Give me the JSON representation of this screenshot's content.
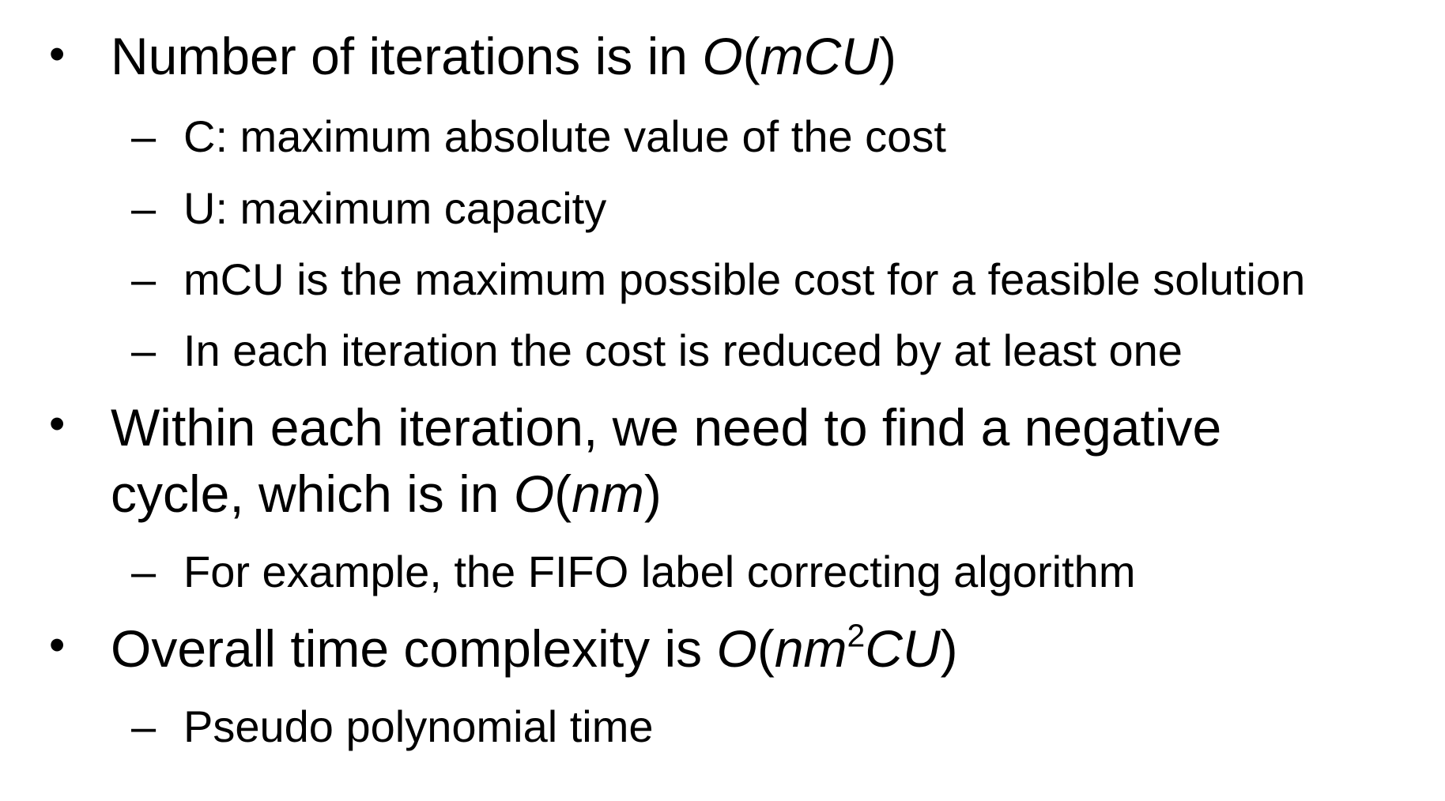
{
  "slide": {
    "bullet_symbol": "•",
    "dash_symbol": "–",
    "items": [
      {
        "text_before": "Number of iterations is in ",
        "math_big": "O",
        "open_paren": "(",
        "math_args": "mCU",
        "close_paren": ")",
        "subitems": [
          "C: maximum absolute value of the cost",
          "U: maximum capacity",
          "mCU is the maximum possible cost for a feasible solution",
          "In each iteration the cost is reduced by at least one"
        ]
      },
      {
        "line1": "Within each iteration, we need to find a negative",
        "line2_before": "cycle, which is in ",
        "math_big": "O",
        "open_paren": "(",
        "math_args": "nm",
        "close_paren": ")",
        "subitems": [
          "For example, the FIFO label correcting algorithm"
        ]
      },
      {
        "text_before": "Overall time complexity is ",
        "math_big": "O",
        "open_paren": "(",
        "math_args_a": "nm",
        "superscript": "2",
        "math_args_b": "CU",
        "close_paren": ")",
        "subitems": [
          "Pseudo polynomial time"
        ]
      }
    ]
  }
}
